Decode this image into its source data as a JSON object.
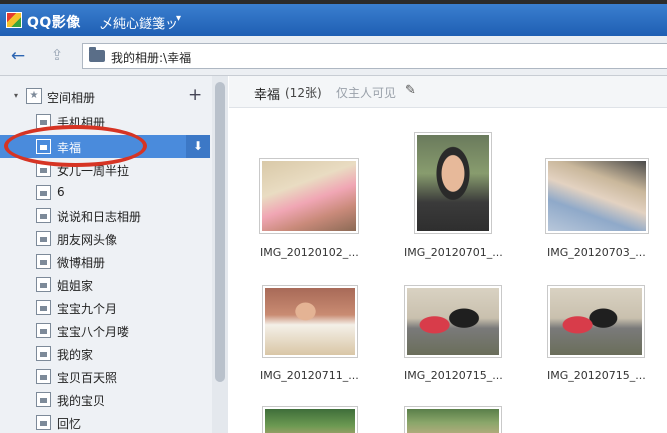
{
  "app": {
    "title": "QQ影像",
    "user": "乄純心鐩箋ッ",
    "user_caret": "▾"
  },
  "nav": {
    "back_icon": "←",
    "up_icon": "⇪",
    "path": "我的相册:\\幸福"
  },
  "sidebar": {
    "title": "空间相册",
    "collapse_icon": "▾",
    "add_icon": "+",
    "items": [
      {
        "label": "手机相册"
      },
      {
        "label": "幸福"
      },
      {
        "label": "女儿一周半拉"
      },
      {
        "label": "6"
      },
      {
        "label": "说说和日志相册"
      },
      {
        "label": "朋友网头像"
      },
      {
        "label": "微博相册"
      },
      {
        "label": "姐姐家"
      },
      {
        "label": "宝宝九个月"
      },
      {
        "label": "宝宝八个月喽"
      },
      {
        "label": "我的家"
      },
      {
        "label": "宝贝百天照"
      },
      {
        "label": "我的宝贝"
      },
      {
        "label": "回忆"
      }
    ],
    "download_icon": "⬇"
  },
  "album": {
    "title": "幸福",
    "count": "(12张)",
    "visibility": "仅主人可见",
    "edit_icon": "✎"
  },
  "photos": [
    {
      "name": "IMG_20120102_..."
    },
    {
      "name": "IMG_20120701_..."
    },
    {
      "name": "IMG_20120703_..."
    },
    {
      "name": "IMG_20120711_..."
    },
    {
      "name": "IMG_20120715_..."
    },
    {
      "name": "IMG_20120715_..."
    },
    {
      "name": ""
    },
    {
      "name": ""
    }
  ]
}
